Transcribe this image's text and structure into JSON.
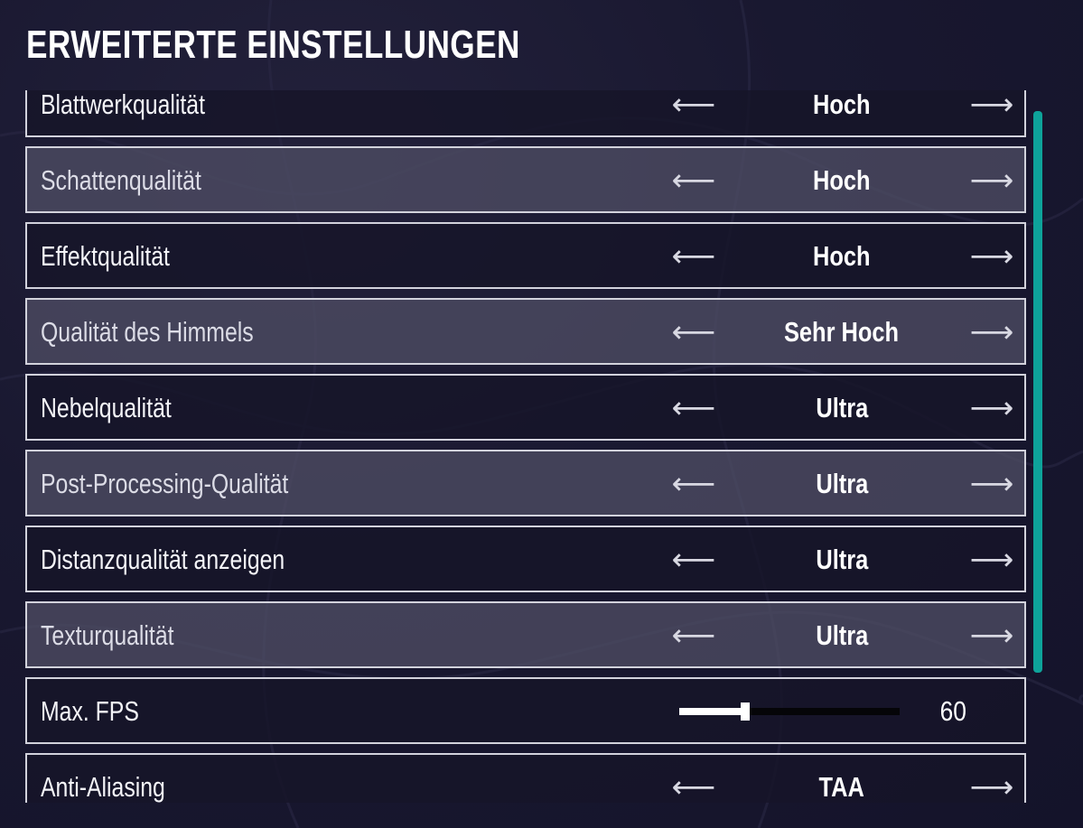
{
  "title": "ERWEITERTE EINSTELLUNGEN",
  "arrows": {
    "left_glyph": "⟵",
    "right_glyph": "⟶",
    "left_icon": "arrow-left-icon",
    "right_icon": "arrow-right-icon"
  },
  "settings": [
    {
      "label": "Blattwerkqualität",
      "value": "Hoch"
    },
    {
      "label": "Schattenqualität",
      "value": "Hoch"
    },
    {
      "label": "Effektqualität",
      "value": "Hoch"
    },
    {
      "label": "Qualität des Himmels",
      "value": "Sehr Hoch"
    },
    {
      "label": "Nebelqualität",
      "value": "Ultra"
    },
    {
      "label": "Post-Processing-Qualität",
      "value": "Ultra"
    },
    {
      "label": "Distanzqualität anzeigen",
      "value": "Ultra"
    },
    {
      "label": "Texturqualität",
      "value": "Ultra"
    },
    {
      "label": "Max. FPS",
      "value": "60",
      "slider_fraction": 0.3
    },
    {
      "label": "Anti-Aliasing",
      "value": "TAA"
    }
  ],
  "colors": {
    "accent_scrollbar": "#0ea39a",
    "border": "#d2d2dc",
    "background": "#191830"
  }
}
